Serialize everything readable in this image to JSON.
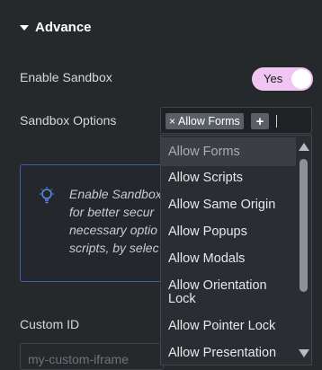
{
  "section": {
    "title": "Advance"
  },
  "enable_sandbox": {
    "label": "Enable Sandbox",
    "toggle_label": "Yes"
  },
  "sandbox_options": {
    "label": "Sandbox Options",
    "selected_tag": "Allow Forms",
    "remove_symbol": "×",
    "add_symbol": "+",
    "options": [
      "Allow Forms",
      "Allow Scripts",
      "Allow Same Origin",
      "Allow Popups",
      "Allow Modals",
      "Allow Orientation Lock",
      "Allow Pointer Lock",
      "Allow Presentation"
    ]
  },
  "info_box": {
    "lines": [
      "Enable Sandbox",
      "for better secur",
      "necessary optio",
      "scripts, by selec"
    ]
  },
  "custom_id": {
    "label": "Custom ID",
    "placeholder": "my-custom-iframe"
  },
  "colors": {
    "accent_toggle": "#f0c5f2",
    "info_border": "#3c5fa8"
  }
}
